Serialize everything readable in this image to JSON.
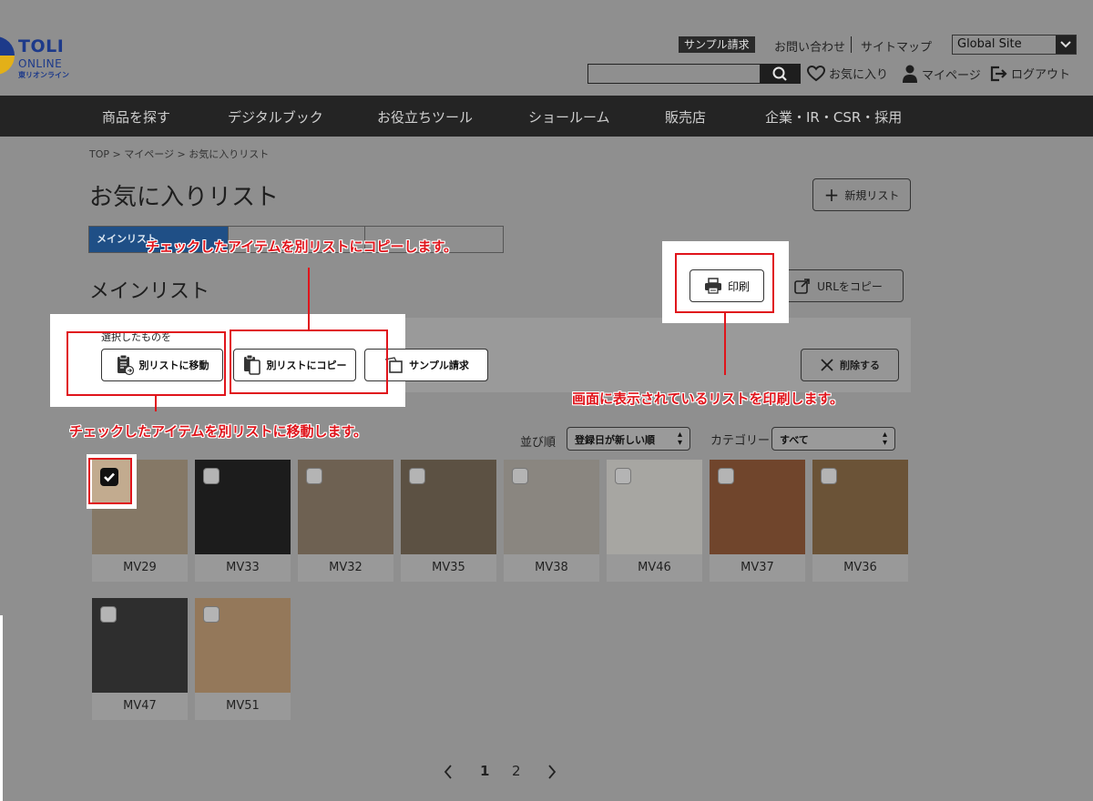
{
  "header": {
    "logo": {
      "line1": "TOLI",
      "line2": "ONLINE",
      "line3": "東リオンライン"
    },
    "links": {
      "sample_request": "サンプル請求",
      "contact": "お問い合わせ",
      "sitemap": "サイトマップ"
    },
    "global_site": "Global Site",
    "search": {
      "placeholder": ""
    },
    "user_links": {
      "favorites": "お気に入り",
      "mypage": "マイページ",
      "logout": "ログアウト"
    }
  },
  "nav": {
    "items": [
      "商品を探す",
      "デジタルブック",
      "お役立ちツール",
      "ショールーム",
      "販売店",
      "企業・IR・CSR・採用"
    ]
  },
  "breadcrumb": "TOP > マイページ > お気に入りリスト",
  "page_title": "お気に入りリスト",
  "new_list_button": "新規リスト",
  "tabs": {
    "main": "メインリスト"
  },
  "list_name": "メインリスト",
  "actions": {
    "select_label": "選択したものを",
    "move": "別リストに移動",
    "copy": "別リストにコピー",
    "sample": "サンプル請求",
    "delete": "削除する",
    "print": "印刷",
    "url_copy": "URLをコピー"
  },
  "callouts": {
    "copy": "チェックしたアイテムを別リストにコピーします。",
    "move": "チェックしたアイテムを別リストに移動します。",
    "print": "画面に表示されているリストを印刷します。"
  },
  "sort": {
    "label": "並び順",
    "value": "登録日が新しい順"
  },
  "category": {
    "label": "カテゴリー",
    "value": "すべて"
  },
  "products": [
    {
      "code": "MV29",
      "color": "#857866",
      "checked": true
    },
    {
      "code": "MV33",
      "color": "#1c1c1c",
      "checked": false
    },
    {
      "code": "MV32",
      "color": "#6e6152",
      "checked": false
    },
    {
      "code": "MV35",
      "color": "#5c5143",
      "checked": false
    },
    {
      "code": "MV38",
      "color": "#8a8680",
      "checked": false
    },
    {
      "code": "MV46",
      "color": "#a7a6a2",
      "checked": false
    },
    {
      "code": "MV37",
      "color": "#70452c",
      "checked": false
    },
    {
      "code": "MV36",
      "color": "#6b5337",
      "checked": false
    },
    {
      "code": "MV47",
      "color": "#2e2e2e",
      "checked": false
    },
    {
      "code": "MV51",
      "color": "#94785a",
      "checked": false
    }
  ],
  "pagination": {
    "prev": "<",
    "pages": [
      "1",
      "2"
    ],
    "next": ">"
  }
}
